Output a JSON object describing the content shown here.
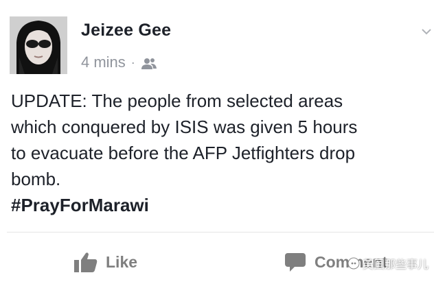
{
  "post": {
    "author": "Jeizee Gee",
    "timestamp": "4 mins",
    "separator": "·",
    "audience_icon": "friends-icon",
    "menu_icon": "chevron-down-icon",
    "text_lines": [
      "UPDATE: The people from selected areas",
      "which conquered by ISIS was given 5 hours",
      "to evacuate before the AFP Jetfighters drop",
      "bomb."
    ],
    "hashtag": "#PrayForMarawi"
  },
  "actions": {
    "like_label": "Like",
    "like_icon": "thumbs-up-icon",
    "comment_label": "Comment",
    "comment_icon": "comment-icon"
  },
  "watermark": {
    "text": "英国那些事儿"
  },
  "colors": {
    "text": "#1d2129",
    "meta": "#90949c",
    "action": "#7f7f7f"
  }
}
